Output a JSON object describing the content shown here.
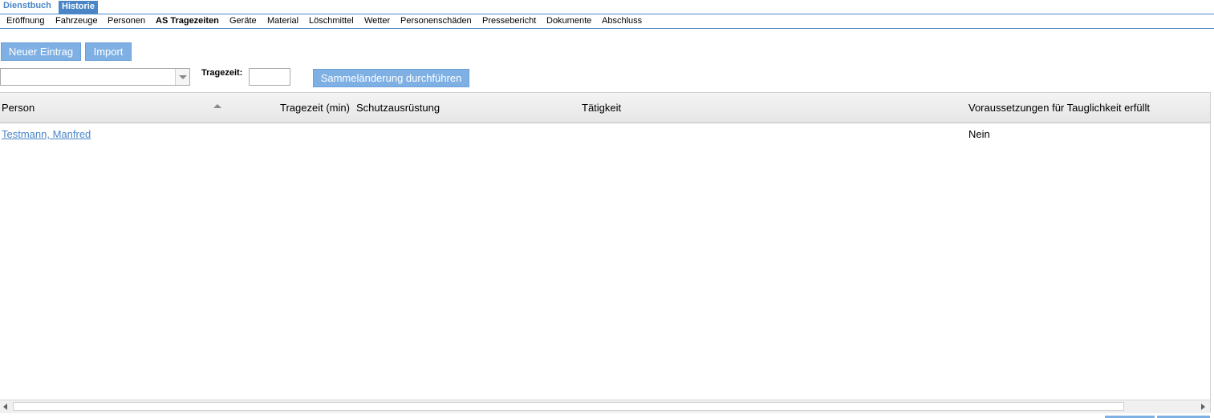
{
  "tabs": {
    "active": "Dienstbuch",
    "history": "Historie"
  },
  "subnav": [
    "Eröffnung",
    "Fahrzeuge",
    "Personen",
    "AS Tragezeiten",
    "Geräte",
    "Material",
    "Löschmittel",
    "Wetter",
    "Personenschäden",
    "Pressebericht",
    "Dokumente",
    "Abschluss"
  ],
  "toolbar": {
    "new_entry": "Neuer Eintrag",
    "import": "Import"
  },
  "filter": {
    "tragezeit_label": "Tragezeit:",
    "bulk_change": "Sammeländerung durchführen"
  },
  "grid": {
    "columns": {
      "person": "Person",
      "tragezeit": "Tragezeit (min)",
      "schutz": "Schutzausrüstung",
      "taetigkeit": "Tätigkeit",
      "voraus": "Voraussetzungen für Tauglichkeit erfüllt"
    },
    "rows": [
      {
        "person": "Testmann, Manfred",
        "tragezeit": "",
        "schutz": "",
        "taetigkeit": "",
        "voraus": "Nein"
      }
    ]
  }
}
